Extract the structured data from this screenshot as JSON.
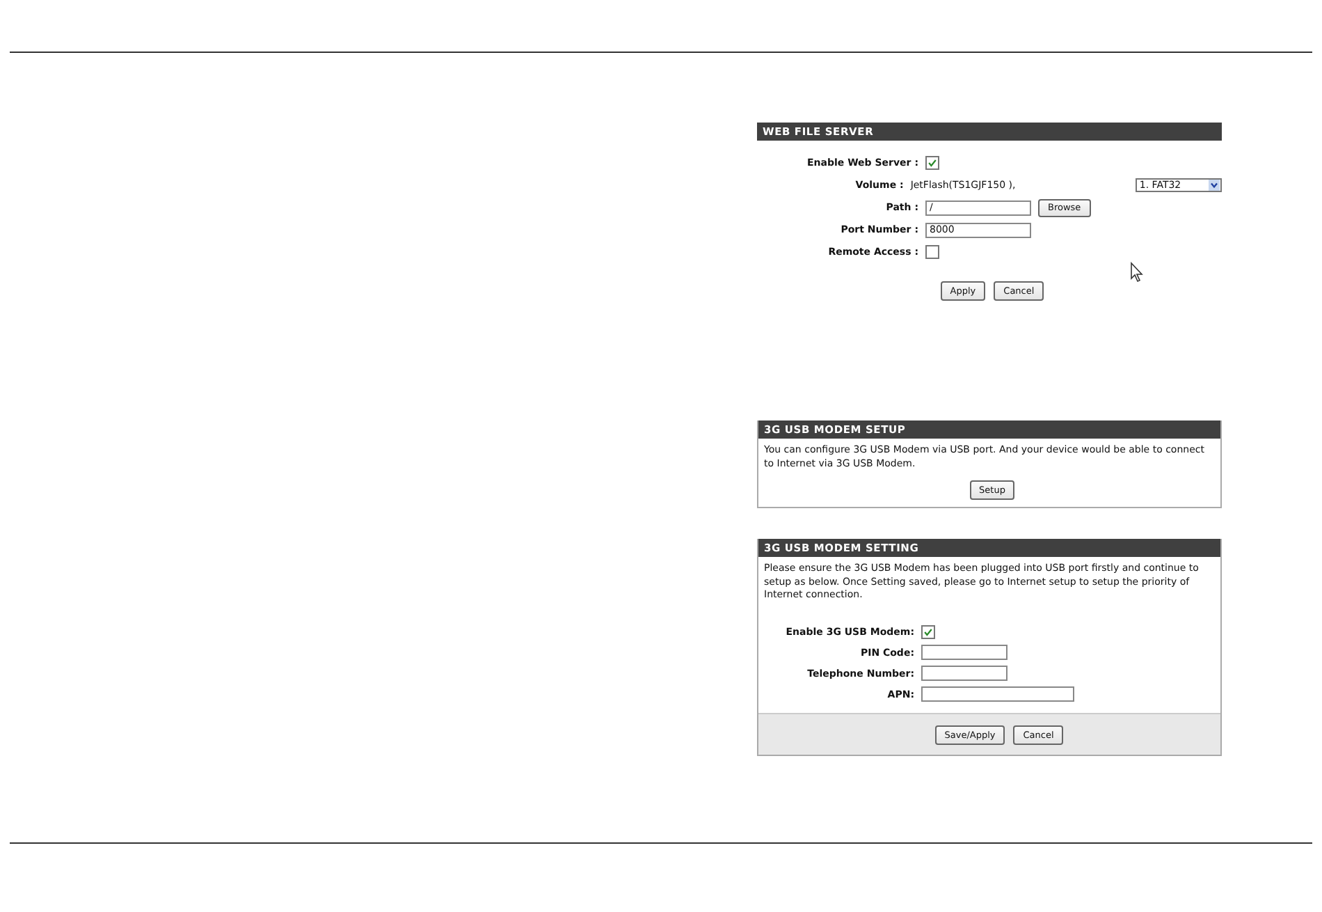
{
  "web_file_server": {
    "title": "WEB FILE SERVER",
    "fields": [
      {
        "kind": "checkbox",
        "label": "Enable Web Server :",
        "checked": true
      },
      {
        "kind": "volume",
        "label": "Volume :",
        "value": "JetFlash(TS1GJF150 ),",
        "select": "1. FAT32"
      },
      {
        "kind": "text",
        "label": "Path :",
        "value": "/",
        "button": "Browse"
      },
      {
        "kind": "text",
        "label": "Port Number :",
        "value": "8000"
      },
      {
        "kind": "checkbox",
        "label": "Remote Access :",
        "checked": false
      }
    ],
    "buttons": [
      "Apply",
      "Cancel"
    ]
  },
  "modem_setup": {
    "title": "3G USB MODEM SETUP",
    "text": "You can configure 3G USB Modem via USB port. And your device would be able to connect to Internet via 3G USB Modem.",
    "button": "Setup"
  },
  "modem_setting": {
    "title": "3G USB MODEM SETTING",
    "text": "Please ensure the 3G USB Modem has been plugged into USB port firstly and continue to setup as below. Once Setting saved, please go to Internet setup to setup the priority of Internet connection.",
    "fields": [
      {
        "kind": "checkbox",
        "label": "Enable 3G USB Modem:",
        "checked": true
      },
      {
        "kind": "text",
        "label": "PIN Code:"
      },
      {
        "kind": "text",
        "label": "Telephone Number:"
      },
      {
        "kind": "wide_text",
        "label": "APN:"
      }
    ],
    "buttons": [
      "Save/Apply",
      "Cancel"
    ]
  }
}
